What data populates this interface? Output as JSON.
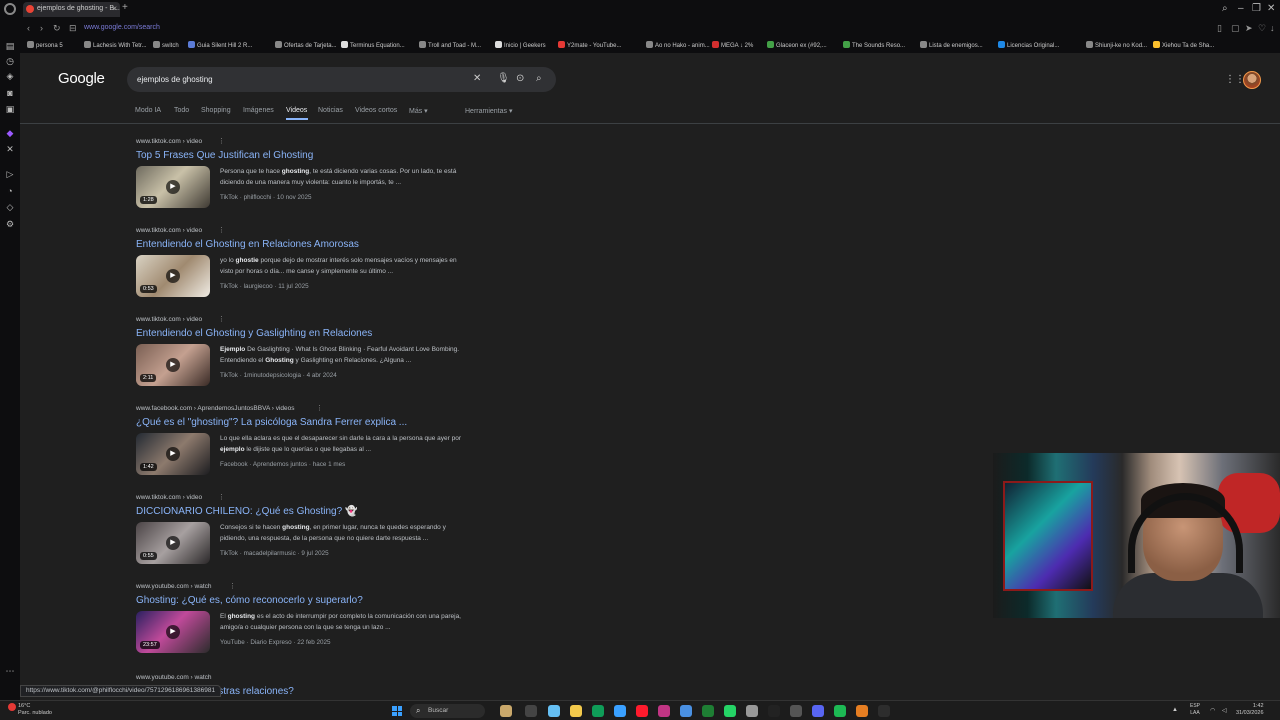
{
  "browser": {
    "tab_title": "ejemplos de ghosting - B...",
    "url": "www.google.com/search",
    "bookmarks": [
      {
        "label": "persona 5",
        "color": "#888888"
      },
      {
        "label": "Lachesis With Tetr...",
        "color": "#888888"
      },
      {
        "label": "switch",
        "color": "#888888"
      },
      {
        "label": "Guia Silent Hill 2 R...",
        "color": "#5b7bd6"
      },
      {
        "label": "Ofertas de Tarjeta...",
        "color": "#888888"
      },
      {
        "label": "Terminus Equation...",
        "color": "#dddddd"
      },
      {
        "label": "Troll and Toad - M...",
        "color": "#888888"
      },
      {
        "label": "Inicio | Geekers",
        "color": "#dddddd"
      },
      {
        "label": "Y2mate - YouTube...",
        "color": "#e53935"
      },
      {
        "label": "Ao no Hako - anim...",
        "color": "#888888"
      },
      {
        "label": "MEGA ↓ 2%",
        "color": "#d32f2f"
      },
      {
        "label": "Glaceon ex (#92,...",
        "color": "#43a047"
      },
      {
        "label": "The Sounds Reso...",
        "color": "#43a047"
      },
      {
        "label": "Lista de enemigos...",
        "color": "#888888"
      },
      {
        "label": "Licencias Original...",
        "color": "#1e88e5"
      },
      {
        "label": "Shiunji-ke no Kod...",
        "color": "#888888"
      },
      {
        "label": "Xiehou Ta de Sha...",
        "color": "#fbc02d"
      }
    ]
  },
  "google": {
    "logo": "Google",
    "query": "ejemplos de ghosting",
    "filters": [
      "Modo IA",
      "Todo",
      "Shopping",
      "Imágenes",
      "Videos",
      "Noticias",
      "Videos cortos",
      "Más ▾",
      "Herramientas ▾"
    ],
    "active_filter": "Videos"
  },
  "results": [
    {
      "source": "www.tiktok.com › video",
      "title": "Top 5 Frases Que Justifican el Ghosting",
      "snippet": "Persona que te hace ghosting, te está diciendo varias cosas. Por un lado, te está diciendo de una manera muy violenta: cuanto le importás, te ...",
      "duration": "1:28",
      "platform": "TikTok",
      "author": "philflocchi",
      "date": "10 nov 2025"
    },
    {
      "source": "www.tiktok.com › video",
      "title": "Entendiendo el Ghosting en Relaciones Amorosas",
      "snippet": "yo lo ghostie porque dejo de mostrar interés solo mensajes vacíos y mensajes en visto por horas o día... me canse y simplemente su último ...",
      "duration": "0:53",
      "platform": "TikTok",
      "author": "laurgiecoo",
      "date": "11 jul 2025"
    },
    {
      "source": "www.tiktok.com › video",
      "title": "Entendiendo el Ghosting y Gaslighting en Relaciones",
      "snippet": "Ejemplo De Gaslighting · What Is Ghost Blinking · Fearful Avoidant Love Bombing. Entendiendo el Ghosting y Gaslighting en Relaciones. ¿Alguna ...",
      "duration": "2:11",
      "platform": "TikTok",
      "author": "1minutodepsicologia",
      "date": "4 abr 2024"
    },
    {
      "source": "www.facebook.com › AprendemosJuntosBBVA › videos",
      "title": "¿Qué es el \"ghosting\"? La psicóloga Sandra Ferrer explica ...",
      "snippet": "Lo que ella aclara es que el desaparecer sin darle la cara a la persona que ayer por ejemplo le dijiste que lo querías o que llegabas al ...",
      "duration": "1:42",
      "platform": "Facebook",
      "author": "Aprendemos juntos",
      "date": "hace 1 mes"
    },
    {
      "source": "www.tiktok.com › video",
      "title": "DICCIONARIO CHILENO: ¿Qué es Ghosting? 👻",
      "snippet": "Consejos si te hacen ghosting, en primer lugar, nunca te quedes esperando y pidiendo, una respuesta, de la persona que no quiere darte respuesta ...",
      "duration": "0:55",
      "platform": "TikTok",
      "author": "macadelpilarmusic",
      "date": "9 jul 2025"
    },
    {
      "source": "www.youtube.com › watch",
      "title": "Ghosting: ¿Qué es, cómo reconocerlo y superarlo?",
      "snippet": "El ghosting es el acto de interrumpir por completo la comunicación con una pareja, amigo/a o cualquier persona con la que se tenga un lazo ...",
      "duration": "23:57",
      "platform": "YouTube",
      "author": "Diario Expreso",
      "date": "22 feb 2025"
    }
  ],
  "partial_result": {
    "source": "www.youtube.com › watch",
    "title": "cómo afecta a nuestras relaciones?"
  },
  "status_url": "https://www.tiktok.com/@philflocchi/video/7571296186961386981",
  "taskbar": {
    "weather_temp": "16°C",
    "weather_desc": "Parc. nublado",
    "search_placeholder": "Buscar",
    "lang_1": "ESP",
    "lang_2": "LAA",
    "time": "1:42",
    "date": "31/03/2026"
  }
}
